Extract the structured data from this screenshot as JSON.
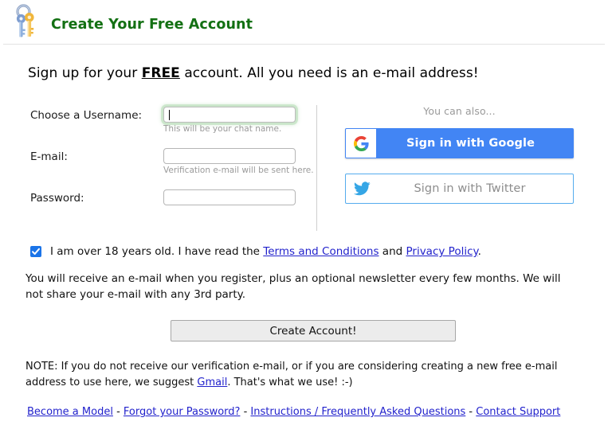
{
  "header": {
    "icon": "keys-icon",
    "title": "Create Your Free Account"
  },
  "intro": {
    "before": "Sign up for your ",
    "emphasis": "FREE",
    "after": " account.  All you need is an e-mail address!"
  },
  "form": {
    "fields": [
      {
        "label": "Choose a Username:",
        "value": "",
        "placeholder": "",
        "hint": "This will be your chat name.",
        "focused": true
      },
      {
        "label": "E-mail:",
        "value": "",
        "placeholder": "",
        "hint": "Verification e-mail will be sent here.",
        "focused": false
      },
      {
        "label": "Password:",
        "value": "",
        "placeholder": "",
        "hint": "",
        "focused": false
      }
    ]
  },
  "social": {
    "hint": "You can also...",
    "google": {
      "label": "Sign in with Google",
      "icon": "google-g-icon",
      "bg_color": "#4285f4",
      "text_color": "#ffffff"
    },
    "twitter": {
      "label": "Sign in with Twitter",
      "icon": "twitter-bird-icon",
      "border_color": "#55acee",
      "text_color": "#8d8d8d"
    }
  },
  "terms": {
    "checked": true,
    "text_before": "I am over 18 years old. I have read the ",
    "link_terms": "Terms and Conditions",
    "text_middle": " and ",
    "link_privacy": "Privacy Policy",
    "text_after": "."
  },
  "newsletter": {
    "text": "You will receive an e-mail when you register, plus an optional newsletter every few months. We will not share your e-mail with any 3rd party."
  },
  "cta": {
    "label": "Create Account!"
  },
  "note": {
    "text_before": "NOTE: If you do not receive our verification e-mail, or if you are considering creating a new free e-mail address to use here, we suggest ",
    "link": "Gmail",
    "text_after": ".  That's what we use! :-)"
  },
  "footer": {
    "separator": " - ",
    "links": [
      "Become a Model",
      "Forgot your Password?",
      "Instructions / Frequently Asked Questions",
      "Contact Support"
    ]
  },
  "colors": {
    "title_green": "#137013",
    "link_blue": "#2222cc",
    "google_blue": "#4285f4",
    "twitter_blue": "#55acee",
    "checkbox_blue": "#1b74e8",
    "focus_glow_green": "#96cd96"
  }
}
